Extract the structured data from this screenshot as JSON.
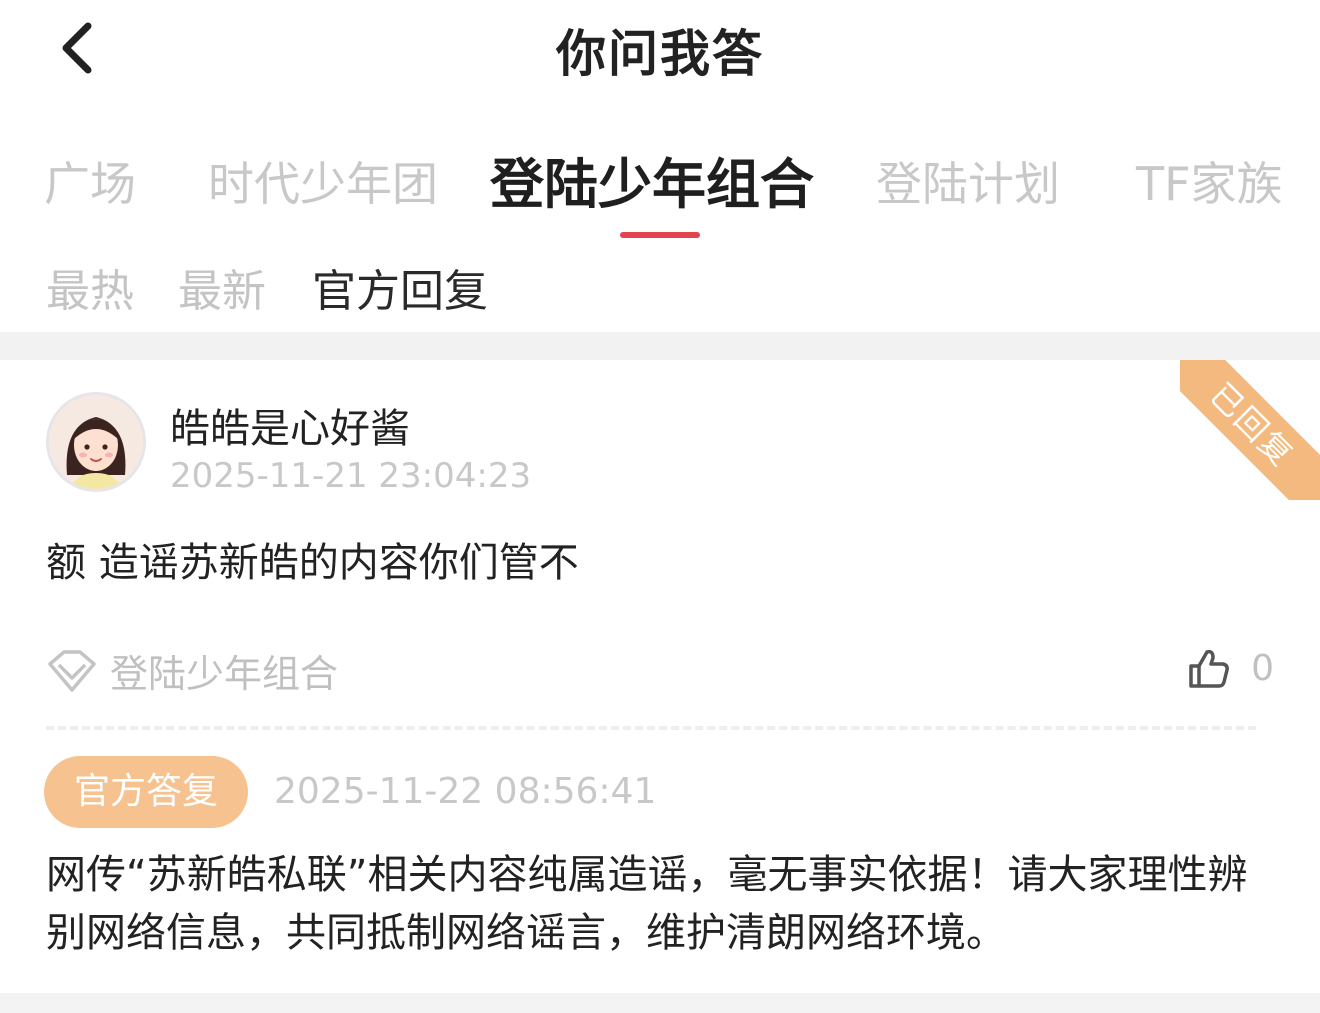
{
  "header": {
    "title": "你问我答",
    "back_icon": "chevron-left-icon"
  },
  "tabs": [
    {
      "label": "广场",
      "active": false
    },
    {
      "label": "时代少年团",
      "active": false
    },
    {
      "label": "登陆少年组合",
      "active": true
    },
    {
      "label": "登陆计划",
      "active": false
    },
    {
      "label": "TF家族",
      "active": false
    }
  ],
  "subtabs": [
    {
      "label": "最热",
      "active": false
    },
    {
      "label": "最新",
      "active": false
    },
    {
      "label": "官方回复",
      "active": true
    }
  ],
  "post": {
    "username": "皓皓是心好酱",
    "time": "2025-11-21 23:04:23",
    "status_ribbon": "已回复",
    "question": "额 造谣苏新皓的内容你们管不",
    "topic": "登陆少年组合",
    "topic_icon": "diamond-icon",
    "like_icon": "thumbs-up-icon",
    "like_count": "0"
  },
  "reply": {
    "badge": "官方答复",
    "time": "2025-11-22 08:56:41",
    "text": "网传“苏新皓私联”相关内容纯属造谣，毫无事实依据！请大家理性辨别网络信息，共同抵制网络谣言，维护清朗网络环境。"
  },
  "colors": {
    "accent": "#e2454d",
    "badge": "#f6c28f",
    "ribbon": "#f3b97e",
    "muted": "#c8c8c8"
  }
}
